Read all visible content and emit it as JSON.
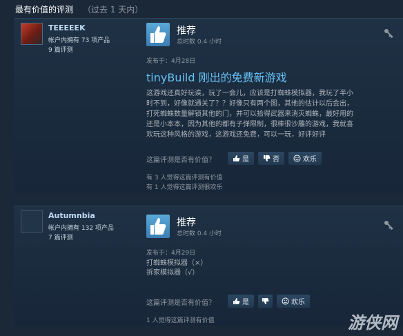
{
  "header": {
    "title": "最有价值的评测",
    "subtitle": "（过去 1 天内）"
  },
  "reviews": [
    {
      "author": {
        "name": "TEEEEEK",
        "products": "帐户内拥有 73 项产品",
        "review_count": "9 篇评测"
      },
      "recommendation": "推荐",
      "hours": "总时数 0.4 小时",
      "posted": "发布于：4月28日",
      "headline": "tinyBuild 刚出的免费新游戏",
      "body": "这游戏还真好玩诶，玩了一会儿，应该是打蜘蛛模拟器，我玩了半小\n时不到，好像就通关了？？好像只有两个图，其他的估计以后会出，\n打死蜘蛛数量解锁其他的门，并可以拾得武器来消灭蜘蛛，最好用的\n还是小本本，因为其他的都有子弹限制，很棒很沙雕的游戏，我就喜\n欢玩这种风格的游戏，这游戏还免费，可以一玩，好评好评",
      "helpful_question": "这篇评测是否有价值？",
      "votes": {
        "yes": "是",
        "no": "否",
        "funny": "欢乐"
      },
      "stats": [
        "有 3 人觉得这篇评测有价值",
        "有 1 人觉得这篇评测很欢乐"
      ]
    },
    {
      "author": {
        "name": "Autumnbia",
        "products": "帐户内拥有 132 项产品",
        "review_count": "7 篇评测"
      },
      "recommendation": "推荐",
      "hours": "总时数 0.4 小时",
      "posted": "发布于：4月29日",
      "body": "打蜘蛛模拟器（×）\n拆家模拟器（√）",
      "helpful_question": "这篇评测是否有价值？",
      "votes": {
        "yes": "是",
        "no": "",
        "funny": "欢乐"
      },
      "stats": [
        "1 人觉得这篇评测有价值"
      ]
    }
  ],
  "watermark": "游侠网",
  "icons": {
    "recommend": "thumbs-up-icon",
    "key": "key-icon",
    "funny": "smiley-icon"
  },
  "colors": {
    "background": "#1b2838",
    "accent": "#66c0f4",
    "thumb": "#4b97c9"
  }
}
